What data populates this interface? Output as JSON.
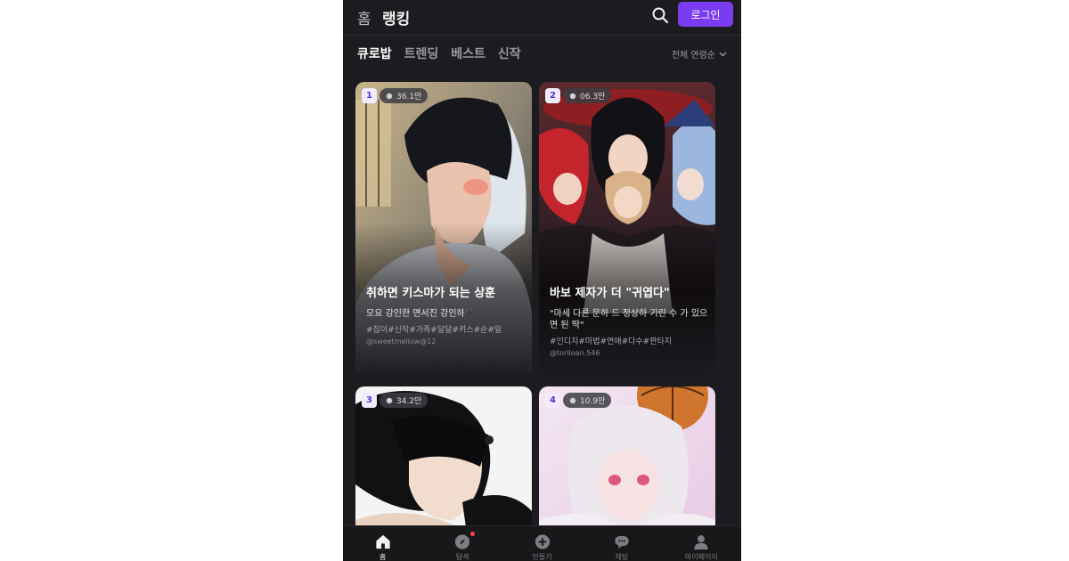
{
  "header": {
    "home_glyph": "홈",
    "title": "랭킹",
    "login_label": "로그인",
    "accent_color": "#7a3cf0"
  },
  "tabs": [
    {
      "label": "큐로밥",
      "active": true
    },
    {
      "label": "트렌딩",
      "active": false
    },
    {
      "label": "베스트",
      "active": false
    },
    {
      "label": "신작",
      "active": false
    }
  ],
  "sort": {
    "label": "전체 연령순"
  },
  "cards": [
    {
      "rank": "1",
      "views": "36.1만",
      "title": "취하면 키스마가 되는 상훈",
      "desc": "모요 강인한 면서진 강인하🖤",
      "tags": "#집이#신작#가족#달달#키스#순#일",
      "author": "@sweetmellow@12"
    },
    {
      "rank": "2",
      "views": "06.3만",
      "title": "바보 제자가 더 \"귀엽다\"",
      "desc": "\"마세 다른 문하 드 정상하 기린 수 가 있으면 된 딱\"",
      "tags": "#인디지#마법#연애#다수#판타지",
      "author": "@toriloan.546"
    },
    {
      "rank": "3",
      "views": "34.2만",
      "title": "",
      "desc": "",
      "tags": "",
      "author": ""
    },
    {
      "rank": "4",
      "views": "10.9만",
      "title": "",
      "desc": "",
      "tags": "",
      "author": ""
    }
  ],
  "bottom_nav": [
    {
      "label": "홈",
      "icon": "home-icon",
      "active": true
    },
    {
      "label": "탐색",
      "icon": "compass-icon",
      "active": false
    },
    {
      "label": "만들기",
      "icon": "plus-circle-icon",
      "active": false
    },
    {
      "label": "채팅",
      "icon": "chat-icon",
      "active": false
    },
    {
      "label": "마이페이지",
      "icon": "person-icon",
      "active": false
    }
  ]
}
